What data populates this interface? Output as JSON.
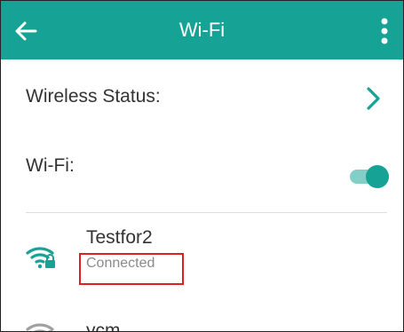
{
  "header": {
    "title": "Wi-Fi",
    "back_icon": "arrow-back-icon",
    "menu_icon": "more-vert-icon"
  },
  "settings": {
    "wireless_status_label": "Wireless Status:",
    "wifi_label": "Wi-Fi:",
    "wifi_enabled": true
  },
  "networks": [
    {
      "name": "Testfor2",
      "status": "Connected",
      "secured": true,
      "icon": "wifi-lock-icon",
      "color": "#16a294"
    },
    {
      "name": "ycm",
      "status": "",
      "secured": true,
      "icon": "wifi-lock-icon",
      "color": "#a0a0a0"
    }
  ],
  "colors": {
    "accent": "#16a294",
    "accent_light": "#83cfc7",
    "highlight_box": "#e01e26",
    "text": "#333333",
    "subtext": "#8a8a8a",
    "inactive_icon": "#a0a0a0"
  }
}
